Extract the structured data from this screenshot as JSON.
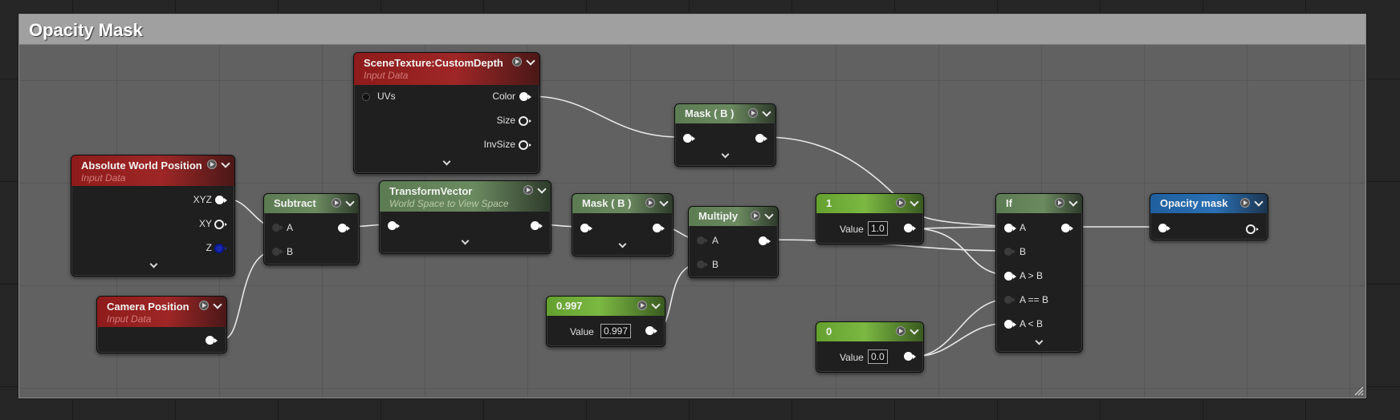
{
  "comment": {
    "title": "Opacity Mask"
  },
  "nodes": {
    "scene_texture": {
      "title": "SceneTexture:CustomDepth",
      "subtitle": "Input Data",
      "inputs": [
        "UVs"
      ],
      "outputs": [
        "Color",
        "Size",
        "InvSize"
      ]
    },
    "absolute_world_position": {
      "title": "Absolute World Position",
      "subtitle": "Input Data",
      "outputs": [
        "XYZ",
        "XY",
        "Z"
      ]
    },
    "camera_position": {
      "title": "Camera Position",
      "subtitle": "Input Data"
    },
    "subtract": {
      "title": "Subtract",
      "inputs": [
        "A",
        "B"
      ]
    },
    "transform_vector": {
      "title": "TransformVector",
      "subtitle": "World Space to View Space"
    },
    "mask_b_1": {
      "title": "Mask ( B )"
    },
    "mask_b_2": {
      "title": "Mask ( B )"
    },
    "multiply": {
      "title": "Multiply",
      "inputs": [
        "A",
        "B"
      ]
    },
    "const_0997": {
      "title": "0.997",
      "value_label": "Value",
      "value": "0.997"
    },
    "const_1": {
      "title": "1",
      "value_label": "Value",
      "value": "1.0"
    },
    "const_0": {
      "title": "0",
      "value_label": "Value",
      "value": "0.0"
    },
    "if": {
      "title": "If",
      "inputs": [
        "A",
        "B",
        "A > B",
        "A == B",
        "A < B"
      ]
    },
    "opacity_mask": {
      "title": "Opacity mask"
    }
  },
  "colors": {
    "input_header": "#9e2626",
    "math_header": "#6b8a60",
    "constant_header": "#7bb842",
    "output_header": "#2a70b4",
    "comment_header": "#a0a0a0",
    "comment_body": "#616161"
  }
}
